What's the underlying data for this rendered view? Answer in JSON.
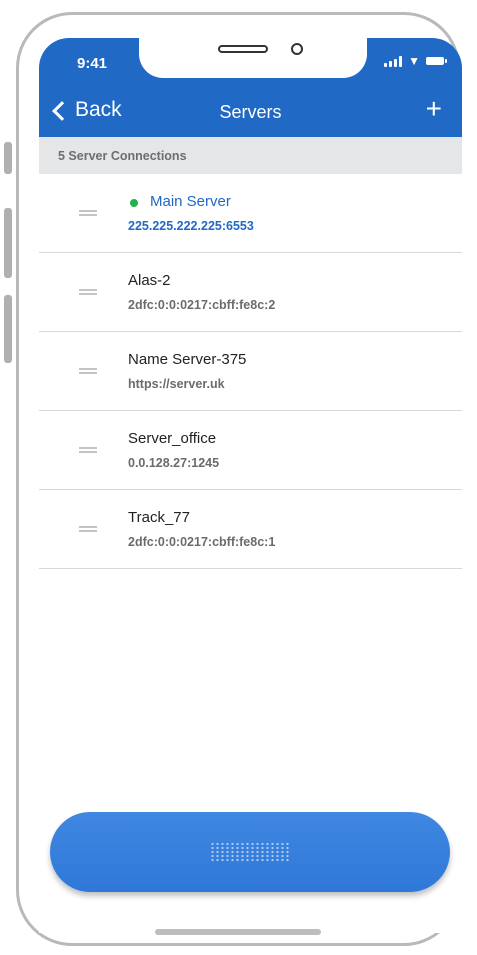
{
  "status_bar": {
    "time": "9:41"
  },
  "nav": {
    "back_label": "Back",
    "title": "Servers",
    "add_label": "+"
  },
  "subheader": {
    "text": "5 Server Connections"
  },
  "servers": [
    {
      "name": "Main Server",
      "address": "225.225.222.225:6553",
      "active": true
    },
    {
      "name": "Alas-2",
      "address": "2dfc:0:0:0217:cbff:fe8c:2",
      "active": false
    },
    {
      "name": "Name Server-375",
      "address": "https://server.uk",
      "active": false
    },
    {
      "name": "Server_office",
      "address": "0.0.128.27:1245",
      "active": false
    },
    {
      "name": "Track_77",
      "address": "2dfc:0:0:0217:cbff:fe8c:1",
      "active": false
    }
  ],
  "colors": {
    "accent": "#2069c5",
    "active_dot": "#22b24c",
    "subheader_bg": "#e4e6e8"
  },
  "icons": {
    "back": "chevron-left-icon",
    "add": "plus-icon",
    "reorder": "drag-handle-icon"
  }
}
